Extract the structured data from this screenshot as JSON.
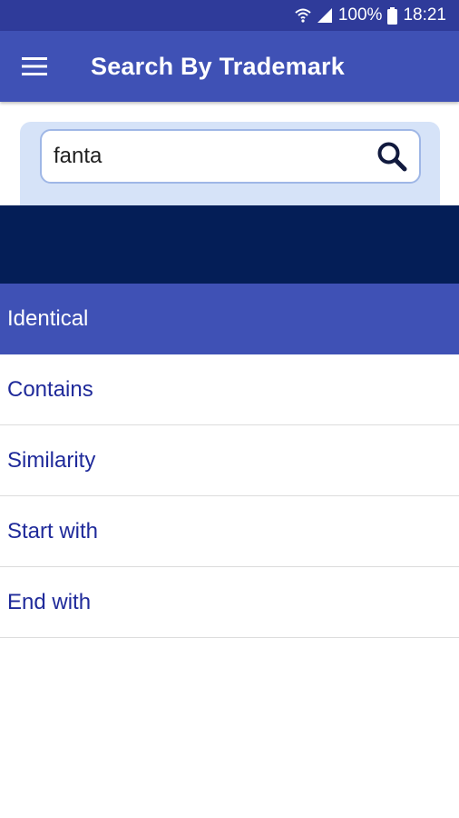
{
  "status_bar": {
    "battery_percent": "100%",
    "time": "18:21",
    "icons": [
      "wifi-icon",
      "signal-icon",
      "battery-icon"
    ]
  },
  "app_bar": {
    "menu_icon": "hamburger-menu-icon",
    "title": "Search By Trademark"
  },
  "search": {
    "value": "fanta",
    "placeholder": "",
    "button_icon": "search-icon"
  },
  "options": [
    {
      "label": "Identical",
      "selected": true
    },
    {
      "label": "Contains",
      "selected": false
    },
    {
      "label": "Similarity",
      "selected": false
    },
    {
      "label": "Start with",
      "selected": false
    },
    {
      "label": "End with",
      "selected": false
    }
  ],
  "colors": {
    "status_bar": "#2f3b9a",
    "app_bar": "#3f51b5",
    "search_panel": "#d6e3f8",
    "dark_band": "#041e57",
    "option_text": "#1f2a9a",
    "selected_option_bg": "#3f51b5"
  }
}
